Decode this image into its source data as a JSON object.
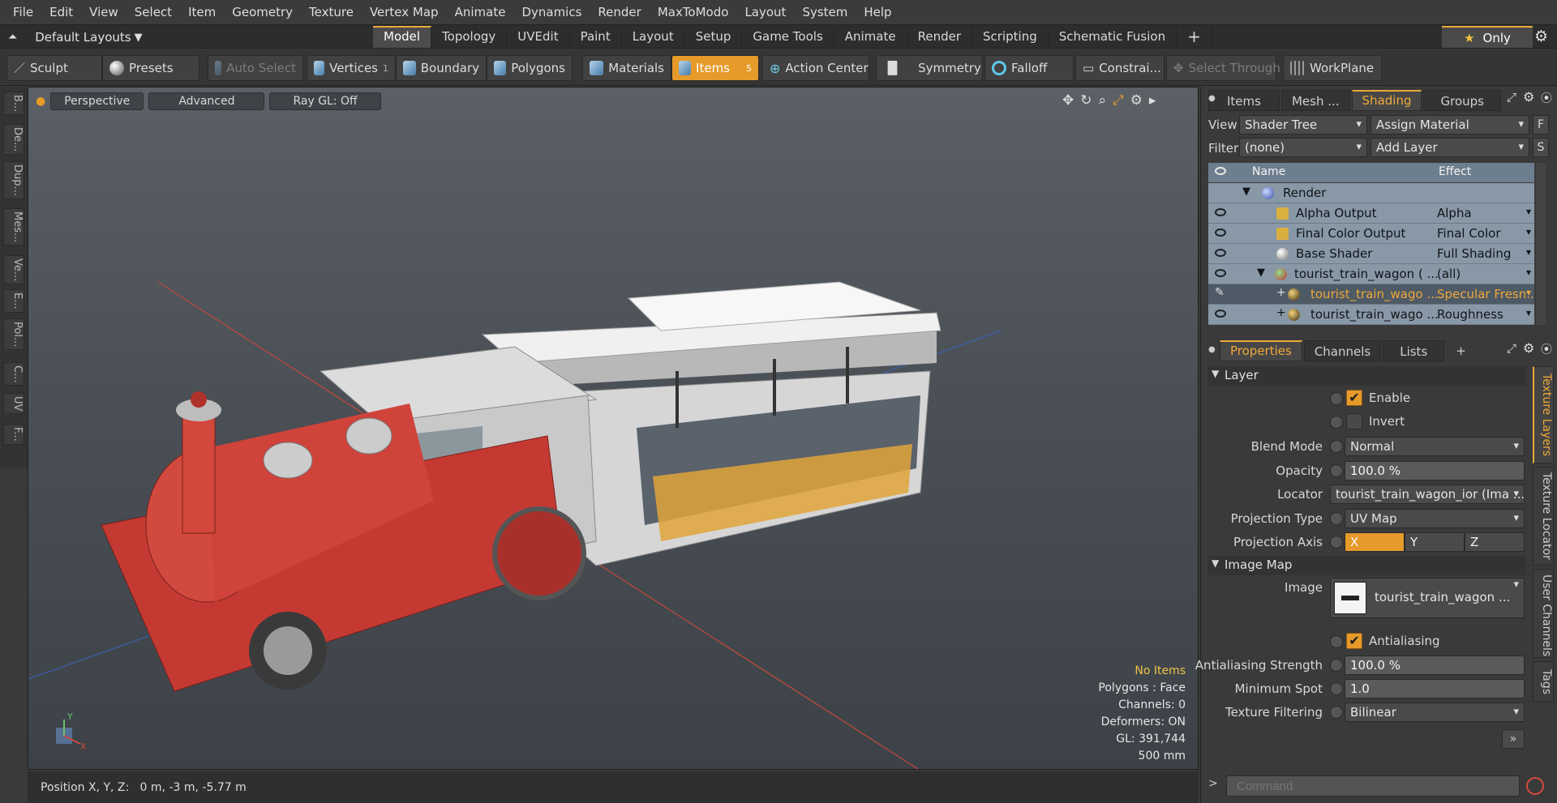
{
  "menu": [
    "File",
    "Edit",
    "View",
    "Select",
    "Item",
    "Geometry",
    "Texture",
    "Vertex Map",
    "Animate",
    "Dynamics",
    "Render",
    "MaxToModo",
    "Layout",
    "System",
    "Help"
  ],
  "layout_menu": "Default Layouts",
  "tabs": [
    "Model",
    "Topology",
    "UVEdit",
    "Paint",
    "Layout",
    "Setup",
    "Game Tools",
    "Animate",
    "Render",
    "Scripting",
    "Schematic Fusion"
  ],
  "active_tab": "Model",
  "only_label": "Only",
  "toolbar": {
    "sculpt": "Sculpt",
    "presets": "Presets",
    "auto_select": "Auto Select",
    "vertices": "Vertices",
    "vertices_count": "1",
    "boundary": "Boundary",
    "polygons": "Polygons",
    "materials": "Materials",
    "items": "Items",
    "items_count": "5",
    "action_center": "Action Center",
    "symmetry": "Symmetry",
    "falloff": "Falloff",
    "constraints": "Constrai...",
    "select_through": "Select Through",
    "workplane": "WorkPlane"
  },
  "left_tabs": [
    "B...",
    "De...",
    "Dup...",
    "Mes...",
    "Ve...",
    "E...",
    "Pol...",
    "C...",
    "UV",
    "F..."
  ],
  "viewport": {
    "view": "Perspective",
    "mode": "Advanced",
    "raygl": "Ray GL: Off",
    "stats": {
      "items": "No Items",
      "polygons": "Polygons : Face",
      "channels": "Channels: 0",
      "deformers": "Deformers: ON",
      "gl": "GL: 391,744",
      "scale": "500 mm"
    }
  },
  "status": "Position X, Y, Z:   0 m, -3 m, -5.77 m",
  "panel_tabs_top": [
    "Items",
    "Mesh ...",
    "Shading",
    "Groups"
  ],
  "panel_active_top": "Shading",
  "shader": {
    "view_label": "View",
    "view_value": "Shader Tree",
    "assign": "Assign Material",
    "assign_key": "F",
    "filter_label": "Filter",
    "filter_value": "(none)",
    "add_layer": "Add Layer",
    "add_key": "S",
    "col_name": "Name",
    "col_effect": "Effect",
    "rows": [
      {
        "name": "Render",
        "effect": ""
      },
      {
        "name": "Alpha Output",
        "effect": "Alpha"
      },
      {
        "name": "Final Color Output",
        "effect": "Final Color"
      },
      {
        "name": "Base Shader",
        "effect": "Full Shading"
      },
      {
        "name": "tourist_train_wagon ( ...",
        "effect": "(all)"
      },
      {
        "name": "tourist_train_wago ...",
        "effect": "Specular Fresn..."
      },
      {
        "name": "tourist_train_wago ...",
        "effect": "Roughness"
      }
    ]
  },
  "panel_tabs_bottom": [
    "Properties",
    "Channels",
    "Lists"
  ],
  "props": {
    "layer": "Layer",
    "enable": "Enable",
    "invert": "Invert",
    "blend_mode_label": "Blend Mode",
    "blend_mode": "Normal",
    "opacity_label": "Opacity",
    "opacity": "100.0 %",
    "locator_label": "Locator",
    "locator": "tourist_train_wagon_ior (Ima ...",
    "projection_type_label": "Projection Type",
    "projection_type": "UV Map",
    "projection_axis_label": "Projection Axis",
    "axis_x": "X",
    "axis_y": "Y",
    "axis_z": "Z",
    "image_map": "Image Map",
    "image_label": "Image",
    "image": "tourist_train_wagon ...",
    "antialiasing": "Antialiasing",
    "aa_strength_label": "Antialiasing Strength",
    "aa_strength": "100.0 %",
    "min_spot_label": "Minimum Spot",
    "min_spot": "1.0",
    "filtering_label": "Texture Filtering",
    "filtering": "Bilinear"
  },
  "right_tabs": [
    "Texture Layers",
    "Texture Locator",
    "User Channels",
    "Tags"
  ],
  "command_placeholder": "Command",
  "colors": {
    "accent": "#e69a2a",
    "selected_text": "#f0a838"
  }
}
